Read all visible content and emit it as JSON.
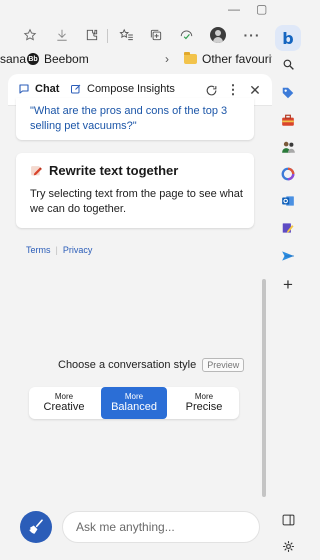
{
  "window": {
    "minimize": "—",
    "restore": "▢",
    "close": "✕"
  },
  "favorites": {
    "items": [
      {
        "label": "sana"
      },
      {
        "label": "Beebom",
        "badge": "Bb"
      },
      {
        "label": "Other favourites"
      }
    ]
  },
  "panel": {
    "tabs": [
      {
        "label": "Chat",
        "active": true
      },
      {
        "label": "Compose",
        "active": false
      },
      {
        "label": "Insights",
        "active": false
      }
    ],
    "suggestion": "\"What are the pros and cons of the top 3 selling pet vacuums?\"",
    "rewrite_card": {
      "title": "Rewrite text together",
      "body": "Try selecting text from the page to see what we can do together."
    },
    "links": {
      "terms": "Terms",
      "privacy": "Privacy"
    },
    "conversation_style": {
      "label": "Choose a conversation style",
      "badge": "Preview",
      "options": [
        {
          "more": "More",
          "name": "Creative",
          "selected": false
        },
        {
          "more": "More",
          "name": "Balanced",
          "selected": true
        },
        {
          "more": "More",
          "name": "Precise",
          "selected": false
        }
      ]
    },
    "input": {
      "placeholder": "Ask me anything..."
    }
  },
  "colors": {
    "accent": "#2b6ed6",
    "link": "#1c56a8",
    "broom_button": "#2b5db8"
  },
  "icons": [
    "star-icon",
    "download-icon",
    "extensions-icon",
    "favorites-icon",
    "collections-icon",
    "performance-icon",
    "profile-avatar",
    "more-icon",
    "bing-copilot-icon",
    "search-icon",
    "tag-icon",
    "toolbox-icon",
    "people-icon",
    "office-icon",
    "outlook-icon",
    "pen-icon",
    "send-icon",
    "add-icon",
    "split-screen-icon",
    "settings-icon",
    "chat-icon",
    "compose-icon",
    "refresh-icon",
    "kebab-icon",
    "close-icon",
    "pencil-note-icon",
    "broom-icon"
  ]
}
